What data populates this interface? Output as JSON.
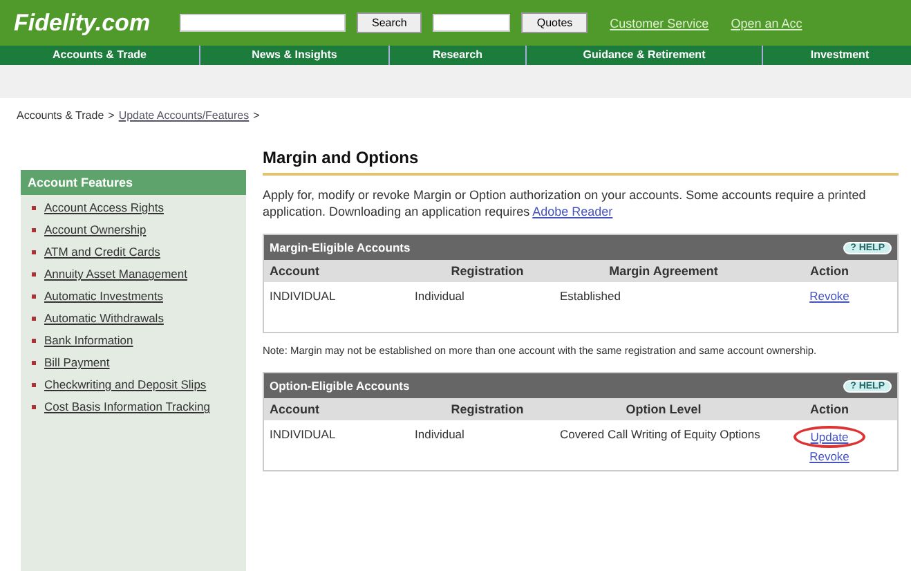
{
  "header": {
    "logo": "Fidelity.com",
    "search_button": "Search",
    "quote_button": "Quotes",
    "links": [
      "Customer Service",
      "Open an Acc"
    ]
  },
  "nav": [
    "Accounts & Trade",
    "News & Insights",
    "Research",
    "Guidance & Retirement",
    "Investment"
  ],
  "breadcrumb": {
    "links": [
      {
        "label": "Accounts & Trade",
        "link": false
      },
      {
        "label": "Update Accounts/Features",
        "link": true
      }
    ],
    "separator": ">"
  },
  "sidebar": {
    "title": "Account Features",
    "items": [
      {
        "label": "Account Access Rights"
      },
      {
        "label": "Account Ownership"
      },
      {
        "label": "ATM and Credit Cards"
      },
      {
        "label": "Annuity Asset Management"
      },
      {
        "label": "Automatic Investments"
      },
      {
        "label": "Automatic Withdrawals"
      },
      {
        "label": "Bank Information"
      },
      {
        "label": "Bill Payment"
      },
      {
        "label": "Checkwriting and Deposit Slips"
      },
      {
        "label": "Cost Basis Information Tracking"
      }
    ]
  },
  "main": {
    "title": "Margin and Options",
    "intro": "Apply for, modify or revoke Margin or Option authorization on your accounts. Some accounts require a printed application. Downloading an application requires ",
    "intro_link": "Adobe Reader",
    "tables": [
      {
        "title": "Margin-Eligible Accounts",
        "help": "? HELP",
        "columns": [
          "Account",
          "Registration",
          "Margin Agreement",
          "Action"
        ],
        "rows": [
          {
            "cells": [
              "INDIVIDUAL",
              "Individual",
              "Established"
            ],
            "actions": [
              {
                "label": "Revoke",
                "circled": false
              }
            ]
          }
        ],
        "note": "Note: Margin may not be established on more than one account with the same registration and same account ownership."
      },
      {
        "title": "Option-Eligible Accounts",
        "help": "? HELP",
        "columns": [
          "Account",
          "Registration",
          "Option Level",
          "Action"
        ],
        "rows": [
          {
            "cells": [
              "INDIVIDUAL",
              "Individual",
              "Covered Call Writing of Equity Options"
            ],
            "actions": [
              {
                "label": "Update",
                "circled": true
              },
              {
                "label": "Revoke",
                "circled": false
              }
            ]
          }
        ]
      }
    ]
  }
}
